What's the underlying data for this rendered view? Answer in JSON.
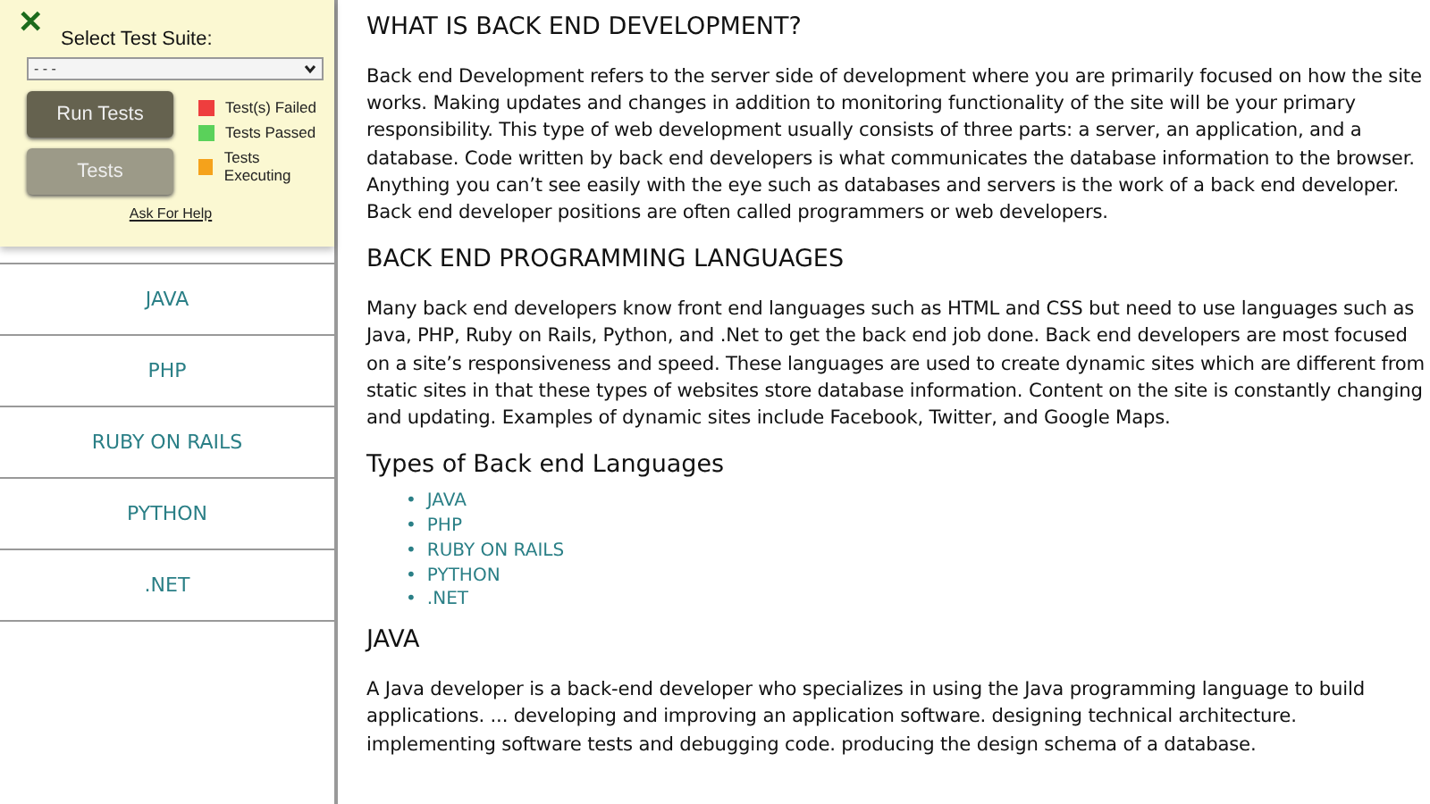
{
  "test_panel": {
    "close": "✕",
    "label": "Select Test Suite:",
    "suite": "- - -",
    "buttons": [
      {
        "label": "Run Tests",
        "kind": "primary"
      },
      {
        "label": "Tests",
        "kind": "secondary"
      }
    ],
    "legend": [
      {
        "label": "Test(s) Failed",
        "color": "#ee3e3e"
      },
      {
        "label": "Tests Passed",
        "color": "#5ad15a"
      },
      {
        "label": "Tests Executing",
        "color": "#f5a21b"
      }
    ],
    "help": "Ask For Help"
  },
  "sidebar": {
    "items": [
      "JAVA",
      "PHP",
      "RUBY ON RAILS",
      "PYTHON",
      ".NET"
    ]
  },
  "content": [
    {
      "kind": "heading",
      "text": "WHAT IS BACK END DEVELOPMENT?"
    },
    {
      "kind": "paragraph",
      "text": "Back end Development refers to the server side of development where you are primarily focused on how the site works. Making updates and changes in addition to monitoring functionality of the site will be your primary responsibility. This type of web development usually consists of three parts: a server, an application, and a database. Code written by back end developers is what communicates the database information to the browser. Anything you can’t see easily with the eye such as databases and servers is the work of a back end developer. Back end developer positions are often called programmers or web developers."
    },
    {
      "kind": "heading",
      "text": "BACK END PROGRAMMING LANGUAGES"
    },
    {
      "kind": "paragraph",
      "text": "Many back end developers know front end languages such as HTML and CSS but need to use languages such as Java, PHP, Ruby on Rails, Python, and .Net to get the back end job done. Back end developers are most focused on a site’s responsiveness and speed. These languages are used to create dynamic sites which are different from static sites in that these types of websites store database information. Content on the site is constantly changing and updating. Examples of dynamic sites include Facebook, Twitter, and Google Maps."
    },
    {
      "kind": "subheading",
      "text": "Types of Back end Languages"
    },
    {
      "kind": "list",
      "marker": "•",
      "items": [
        "JAVA",
        "PHP",
        "RUBY ON RAILS",
        "PYTHON",
        ".NET"
      ]
    },
    {
      "kind": "heading",
      "text": "JAVA"
    },
    {
      "kind": "paragraph",
      "text": "A Java developer is a back-end developer who specializes in using the Java programming language to build applications. ... developing and improving an application software. designing technical architecture. implementing software tests and debugging code. producing the design schema of a database."
    }
  ]
}
